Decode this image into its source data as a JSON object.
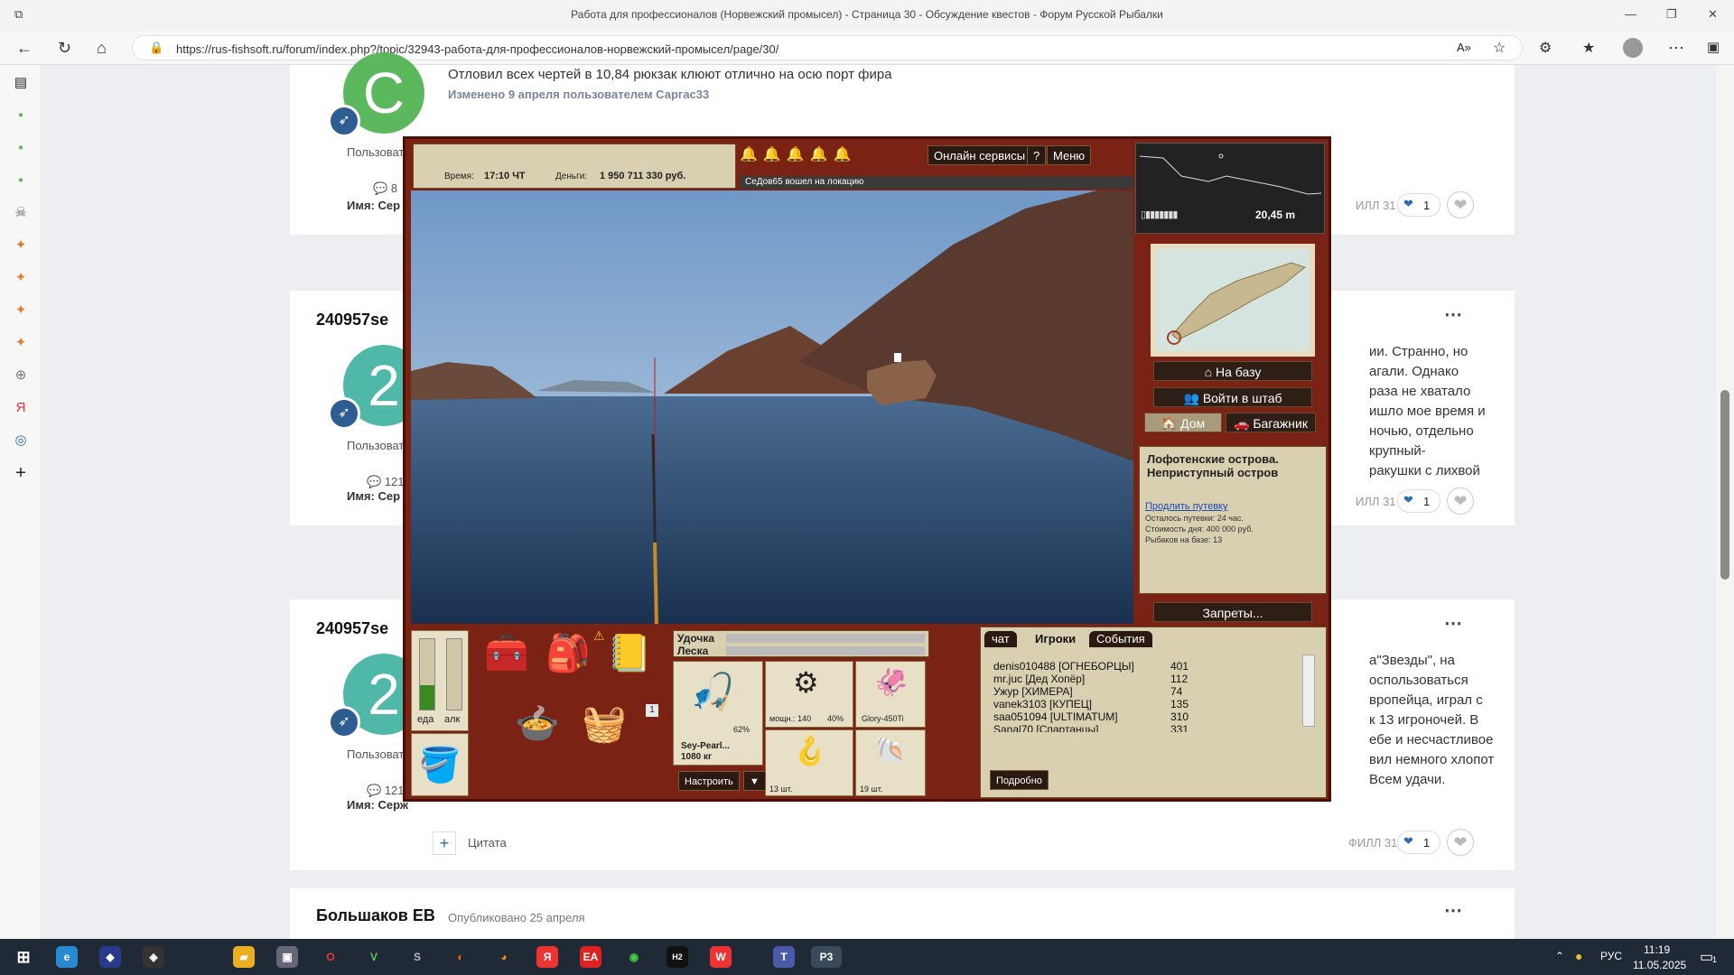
{
  "browser": {
    "title": "Работа для профессионалов (Норвежский промысел) - Страница 30 - Обсуждение квестов - Форум Русской Рыбалки",
    "url": "https://rus-fishsoft.ru/forum/index.php?/topic/32943-работа-для-профессионалов-норвежский-промысел/page/30/",
    "read_aloud_icon": "A»"
  },
  "posts": [
    {
      "avatar_letter": "C",
      "avatar_color": "#5cb85c",
      "role": "Пользоват",
      "post_count": "8",
      "name_label": "Имя: Сер",
      "text": "Отловил всех чертей в 10,84 рюкзак клюют отлично на осю порт фира",
      "edited": "Изменено 9 апреля пользователем Саргас33",
      "like_user": "ИЛЛ 31",
      "like_count": "1"
    },
    {
      "username": "240957se",
      "avatar_letter": "2",
      "avatar_color": "#4fb8a8",
      "role": "Пользоват",
      "post_count": "121",
      "name_label": "Имя: Сер",
      "lines": [
        "ии. Странно, но",
        "агали. Однако",
        "раза не хватало",
        "ишло мое время и",
        "ночью, отдельно",
        "крупный-",
        "ракушки с лихвой"
      ],
      "like_user": "ИЛЛ 31",
      "like_count": "1"
    },
    {
      "username": "240957se",
      "avatar_letter": "2",
      "avatar_color": "#4fb8a8",
      "role": "Пользоват",
      "post_count": "121",
      "name_label": "Имя: Серж",
      "lines": [
        "а\"Звезды\", на",
        "оспользоваться",
        "вропейца, играл с",
        "к 13 игроночей. В",
        "ебе и несчастливое",
        "вил немного хлопот",
        "Всем удачи."
      ],
      "quote_label": "Цитата",
      "like_user": "ФИЛЛ 31",
      "like_count": "1"
    },
    {
      "username": "Большаков ЕВ",
      "published": "Опубликовано 25 апреля"
    }
  ],
  "game": {
    "time_label": "Время:",
    "time_value": "17:10 ЧТ",
    "money_label": "Деньги:",
    "money_value": "1 950 711 330 руб.",
    "online_services": "Онлайн сервисы",
    "help": "?",
    "menu": "Меню",
    "notice": "СеДов65 вошел на локацию",
    "depth": "20,45 m",
    "to_base": "На базу",
    "enter_hq": "Войти в штаб",
    "home_tab": "Дом",
    "trunk_tab": "Багажник",
    "location_title": "Лофотенские острова. Неприступный остров",
    "extend_link": "Продлить путевку",
    "remaining": "Осталось путевки: 24 час.",
    "cost": "Стоимость дня: 400 000 руб.",
    "fishers": "Рыбаков на базе: 13",
    "bans": "Запреты...",
    "food_label": "еда",
    "alc_label": "алк",
    "food_level": 0.35,
    "alc_level": 0,
    "counter_1": "1",
    "rod_label": "Удочка",
    "line_label": "Леска",
    "rod_name": "Sey-Pearl...",
    "rod_weight": "1080 кг",
    "rod_pct": "62%",
    "reel_power": "мощн.: 140",
    "reel_pct": "40%",
    "lure_name": "Glory-450Ti",
    "bait_count": "13 шт.",
    "shell_count": "19 шт.",
    "setup_btn": "Настроить",
    "dropdown": "▼",
    "chat_tabs": [
      "чат",
      "Игроки",
      "События"
    ],
    "players": [
      {
        "name": "denis010488 [ОГНЕБОРЦЫ]",
        "score": "401"
      },
      {
        "name": "mr.juc [Дед Хопёр]",
        "score": "112"
      },
      {
        "name": "Ужур [ХИМЕРА]",
        "score": "74"
      },
      {
        "name": "vanek3103 [КУПЕЦ]",
        "score": "135"
      },
      {
        "name": "saa051094 [ULTIMATUM]",
        "score": "310"
      },
      {
        "name": "Sanal70 [Спартанцы]",
        "score": "331"
      }
    ],
    "details_btn": "Подробно"
  },
  "taskbar": {
    "lang": "РУС",
    "time": "11:19",
    "date": "11.05.2025",
    "notif": "1"
  }
}
